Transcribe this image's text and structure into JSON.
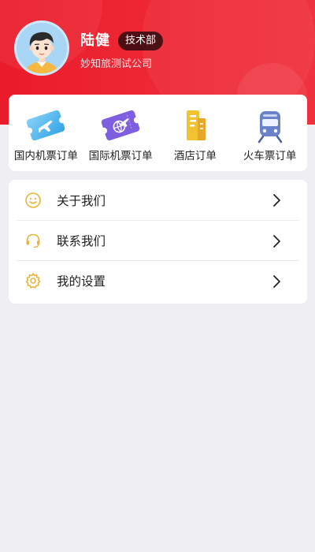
{
  "profile": {
    "name": "陆健",
    "department": "技术部",
    "company": "妙知旅测试公司"
  },
  "orders": [
    {
      "label": "国内机票订单",
      "icon": "domestic-flight-ticket-icon"
    },
    {
      "label": "国际机票订单",
      "icon": "international-flight-ticket-icon"
    },
    {
      "label": "酒店订单",
      "icon": "hotel-building-icon"
    },
    {
      "label": "火车票订单",
      "icon": "train-icon"
    }
  ],
  "menu": [
    {
      "label": "关于我们",
      "icon": "smiley-icon"
    },
    {
      "label": "联系我们",
      "icon": "headset-icon"
    },
    {
      "label": "我的设置",
      "icon": "gear-icon"
    }
  ],
  "colors": {
    "brand_red": "#ea1b2a",
    "icon_gold": "#e8b53a",
    "background": "#eeeef3"
  }
}
